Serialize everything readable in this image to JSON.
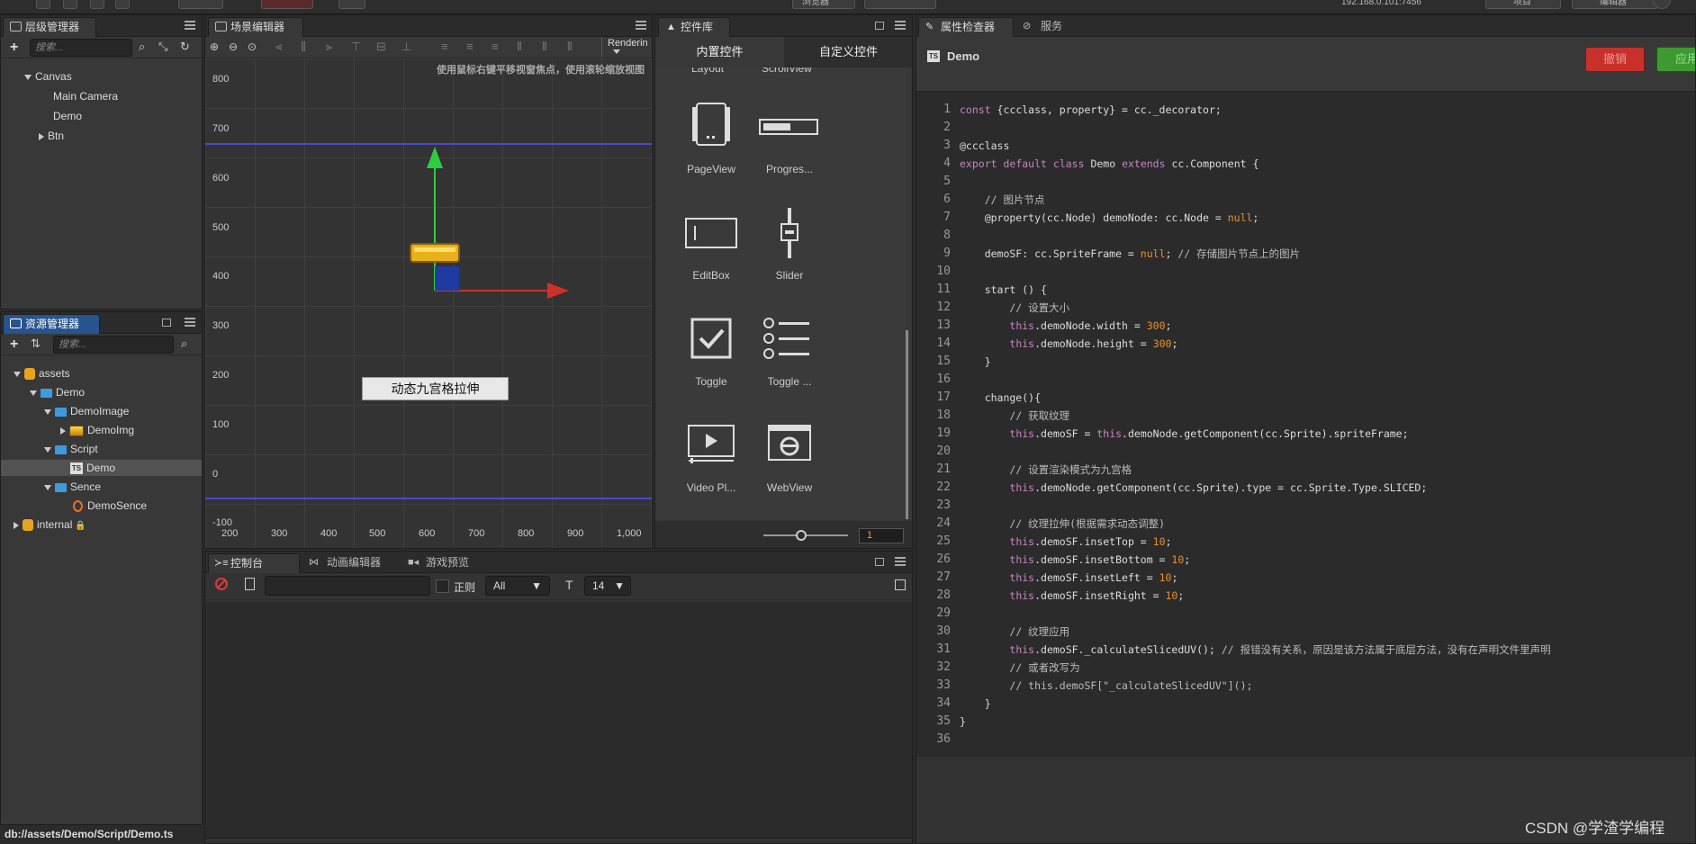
{
  "topbar": {
    "preview_label": "浏览器",
    "ip_label": "192.168.0.101:7456",
    "project_button": "项目",
    "editor_button": "编辑器"
  },
  "hierarchy": {
    "tab_label": "层级管理器",
    "search_placeholder": "搜索...",
    "items": [
      "Canvas",
      "Main Camera",
      "Demo",
      "Btn"
    ]
  },
  "assets": {
    "tab_label": "资源管理器",
    "search_placeholder": "搜索...",
    "items": [
      "assets",
      "Demo",
      "DemoImage",
      "DemoImg",
      "Script",
      "Demo",
      "Sence",
      "DemoSence",
      "internal"
    ]
  },
  "status_bar": {
    "path": "db://assets/Demo/Script/Demo.ts"
  },
  "scene": {
    "tab_label": "场景编辑器",
    "rendering_label": "Renderin",
    "hint": "使用鼠标右键平移视窗焦点，使用滚轮缩放视图",
    "y_ticks": [
      "800",
      "700",
      "600",
      "500",
      "400",
      "300",
      "200",
      "100",
      "0",
      "-100"
    ],
    "x_ticks": [
      "200",
      "300",
      "400",
      "500",
      "600",
      "700",
      "800",
      "900",
      "1,000"
    ],
    "node_label": "动态九宫格拉伸"
  },
  "widget_library": {
    "tab_label": "控件库",
    "tabs": [
      "内置控件",
      "自定义控件"
    ],
    "partial_labels": [
      "Layout",
      "ScrollView"
    ],
    "widgets": [
      "PageView",
      "Progres...",
      "EditBox",
      "Slider",
      "Toggle",
      "Toggle ...",
      "Video Pl...",
      "WebView"
    ],
    "zoom_value": "1"
  },
  "console": {
    "tabs": [
      "控制台",
      "动画编辑器",
      "游戏预览"
    ],
    "regex_label": "正则",
    "filter_value": "All",
    "font_size_value": "14"
  },
  "inspector": {
    "tabs": [
      "属性检查器",
      "服务"
    ],
    "file_name": "Demo",
    "revert_button": "撤销",
    "apply_button": "应用"
  },
  "code": {
    "line_numbers": [
      "1",
      "2",
      "3",
      "4",
      "5",
      "6",
      "7",
      "8",
      "9",
      "10",
      "11",
      "12",
      "13",
      "14",
      "15",
      "16",
      "17",
      "18",
      "19",
      "20",
      "21",
      "22",
      "23",
      "24",
      "25",
      "26",
      "27",
      "28",
      "29",
      "30",
      "31",
      "32",
      "33",
      "34",
      "35",
      "36"
    ],
    "lines": [
      "const {ccclass, property} = cc._decorator;",
      "",
      "@ccclass",
      "export default class Demo extends cc.Component {",
      "",
      "    // 图片节点",
      "    @property(cc.Node) demoNode: cc.Node = null;",
      "",
      "    demoSF: cc.SpriteFrame = null; // 存储图片节点上的图片",
      "",
      "    start () {",
      "        // 设置大小",
      "        this.demoNode.width = 300;",
      "        this.demoNode.height = 300;",
      "    }",
      "",
      "    change(){",
      "        // 获取纹理",
      "        this.demoSF = this.demoNode.getComponent(cc.Sprite).spriteFrame;",
      "",
      "        // 设置渲染模式为九宫格",
      "        this.demoNode.getComponent(cc.Sprite).type = cc.Sprite.Type.SLICED;",
      "",
      "        // 纹理拉伸(根据需求动态调整)",
      "        this.demoSF.insetTop = 10;",
      "        this.demoSF.insetBottom = 10;",
      "        this.demoSF.insetLeft = 10;",
      "        this.demoSF.insetRight = 10;",
      "",
      "        // 纹理应用",
      "        this.demoSF._calculateSlicedUV(); // 报错没有关系，原因是该方法属于底层方法，没有在声明文件里声明",
      "        // 或者改写为",
      "        // this.demoSF[\"_calculateSlicedUV\"]();",
      "    }",
      "}",
      ""
    ]
  },
  "watermark": "CSDN @学渣学编程"
}
